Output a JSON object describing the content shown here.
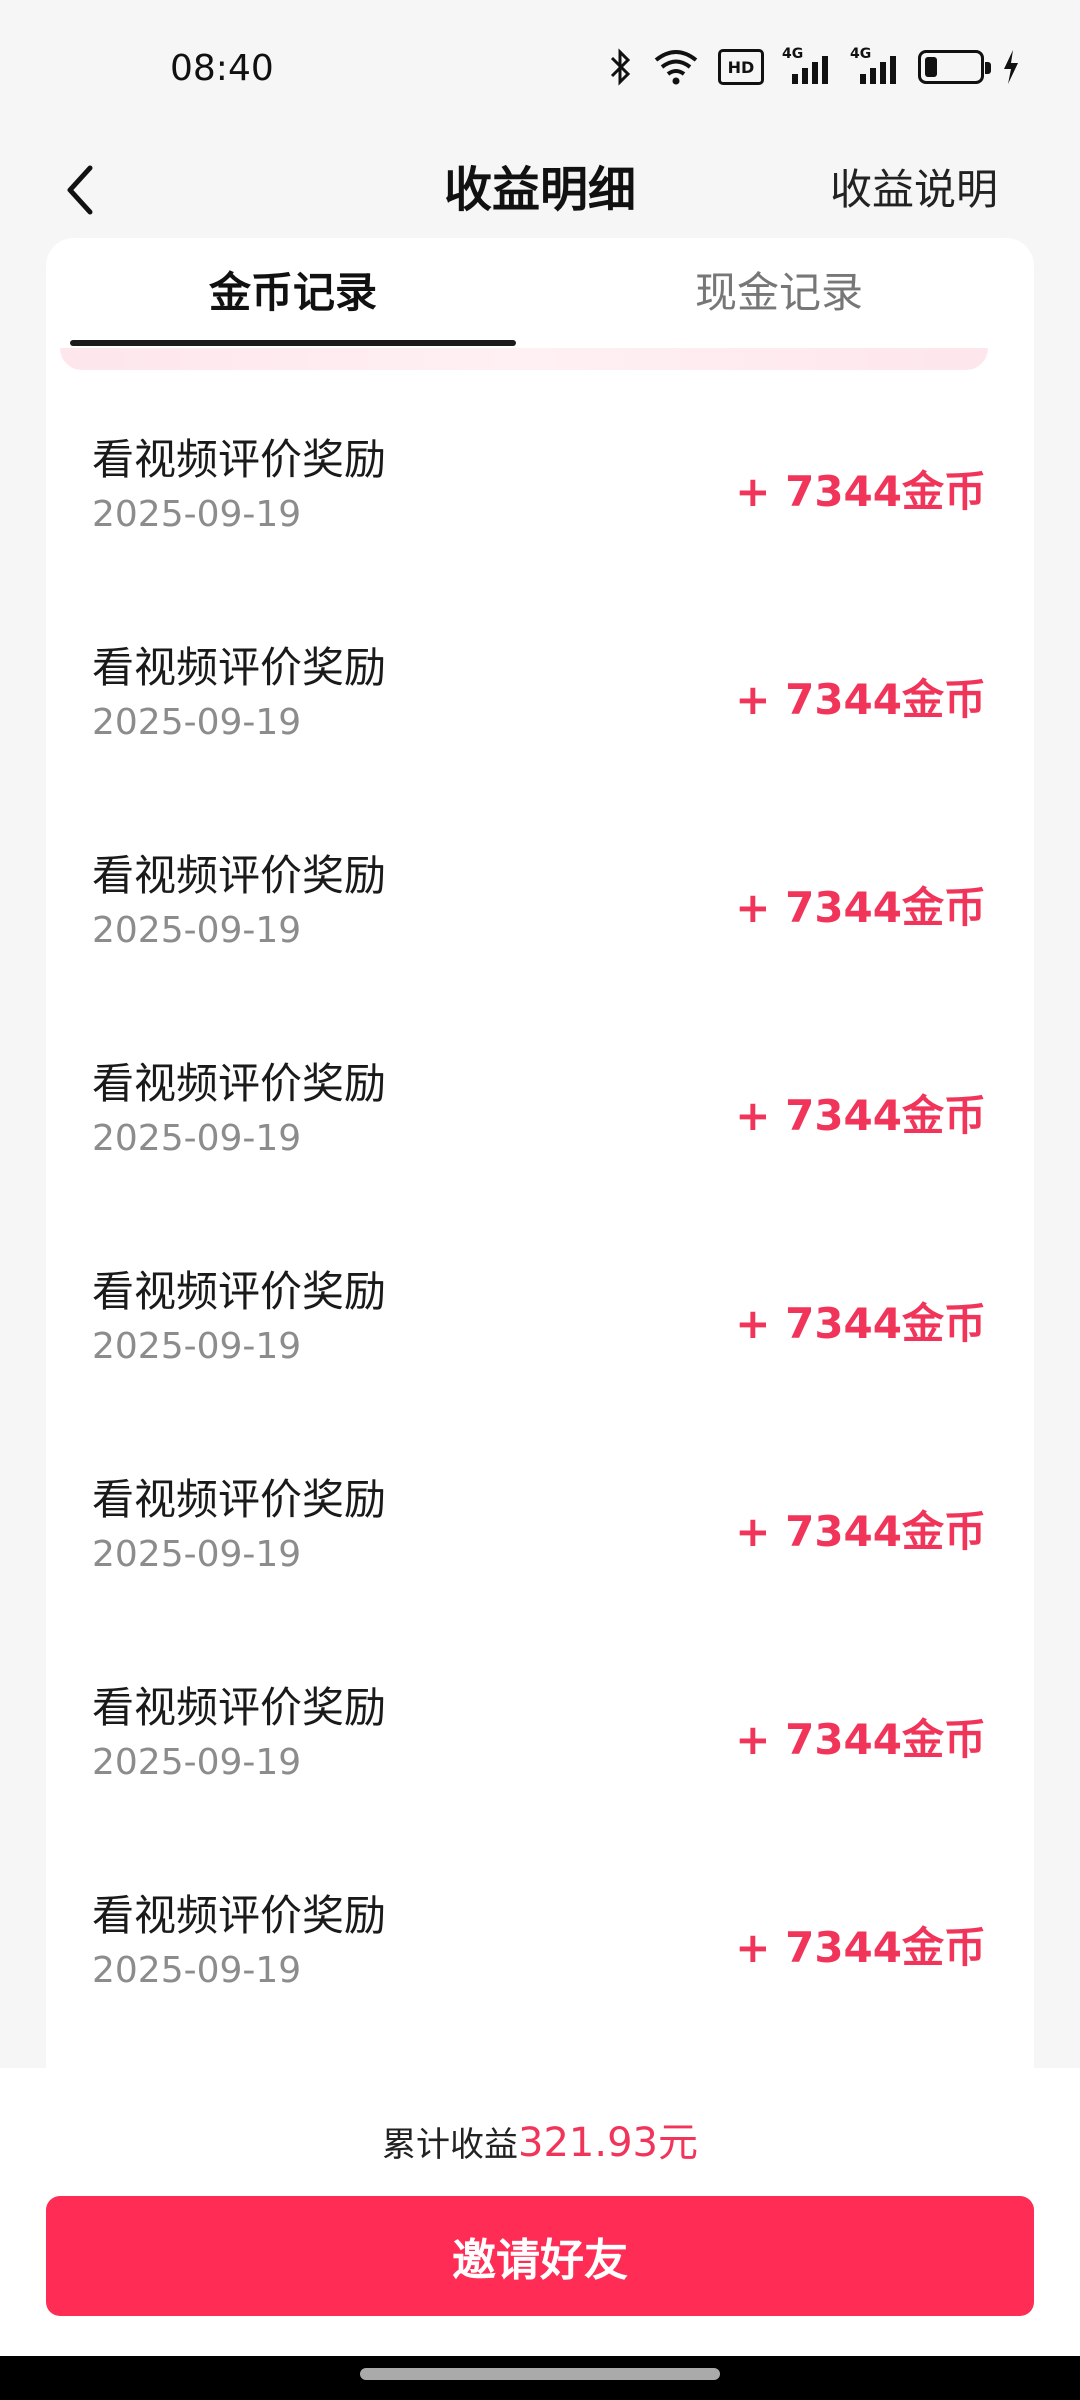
{
  "status_bar": {
    "time": "08:40",
    "icons": [
      "bluetooth-icon",
      "wifi-icon",
      "hd-icon",
      "signal-4g-icon",
      "signal-4g-icon",
      "battery-icon",
      "charging-icon"
    ],
    "hd_label": "HD",
    "net_label": "4G"
  },
  "header": {
    "title": "收益明细",
    "help_link": "收益说明"
  },
  "tabs": [
    {
      "label": "金币记录",
      "active": true
    },
    {
      "label": "现金记录",
      "active": false
    }
  ],
  "records": [
    {
      "title": "看视频评价奖励",
      "date": "2025-09-19",
      "amount": "+ 7344金币"
    },
    {
      "title": "看视频评价奖励",
      "date": "2025-09-19",
      "amount": "+ 7344金币"
    },
    {
      "title": "看视频评价奖励",
      "date": "2025-09-19",
      "amount": "+ 7344金币"
    },
    {
      "title": "看视频评价奖励",
      "date": "2025-09-19",
      "amount": "+ 7344金币"
    },
    {
      "title": "看视频评价奖励",
      "date": "2025-09-19",
      "amount": "+ 7344金币"
    },
    {
      "title": "看视频评价奖励",
      "date": "2025-09-19",
      "amount": "+ 7344金币"
    },
    {
      "title": "看视频评价奖励",
      "date": "2025-09-19",
      "amount": "+ 7344金币"
    },
    {
      "title": "看视频评价奖励",
      "date": "2025-09-19",
      "amount": "+ 7344金币"
    }
  ],
  "footer": {
    "total_label": "累计收益",
    "total_amount": "321.93元",
    "invite_button": "邀请好友"
  },
  "colors": {
    "accent": "#f0345a",
    "button": "#ff2d55",
    "background": "#f6f6f6"
  }
}
